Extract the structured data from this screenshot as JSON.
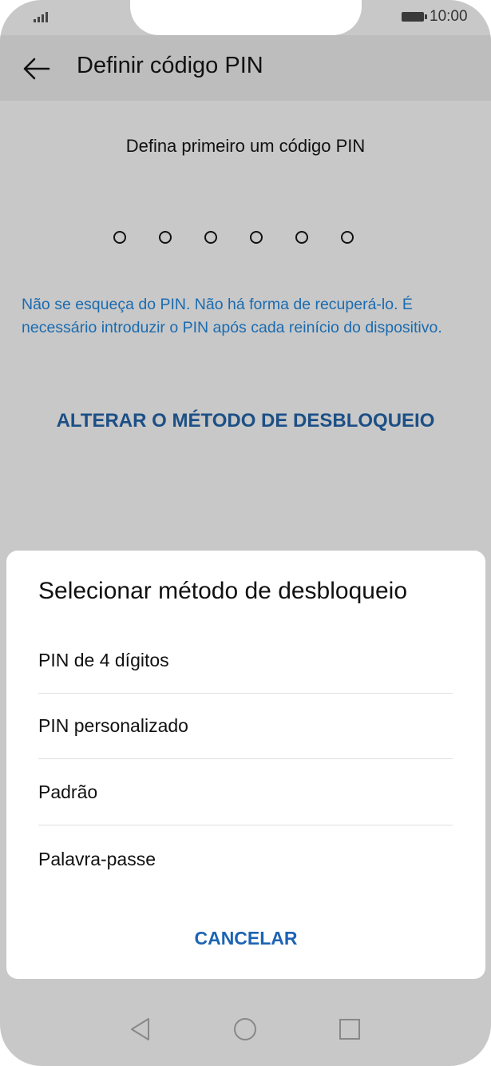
{
  "status_bar": {
    "time": "10:00",
    "signal_icon": "signal-bars-icon",
    "battery_icon": "battery-icon"
  },
  "appbar": {
    "title": "Definir código PIN",
    "back_icon": "arrow-left-icon"
  },
  "main": {
    "prompt": "Defina primeiro um código PIN",
    "pin_length": 6,
    "warning": "Não se esqueça do PIN. Não há forma de recuperá-lo. É necessário introduzir o PIN após cada reinício do dispositivo.",
    "change_method_label": "ALTERAR O MÉTODO DE DESBLOQUEIO"
  },
  "sheet": {
    "title": "Selecionar método de desbloqueio",
    "options": [
      {
        "label": "PIN de 4 dígitos"
      },
      {
        "label": "PIN personalizado"
      },
      {
        "label": "Padrão"
      },
      {
        "label": "Palavra-passe"
      }
    ],
    "cancel_label": "CANCELAR"
  },
  "navbar": {
    "back_icon": "triangle-back-icon",
    "home_icon": "circle-home-icon",
    "recents_icon": "square-recents-icon"
  },
  "colors": {
    "overlay_bg": "#c8c8c8",
    "appbar_bg": "#bdbdbd",
    "warning_text": "#1a6bb0",
    "accent": "#1c64b4"
  }
}
